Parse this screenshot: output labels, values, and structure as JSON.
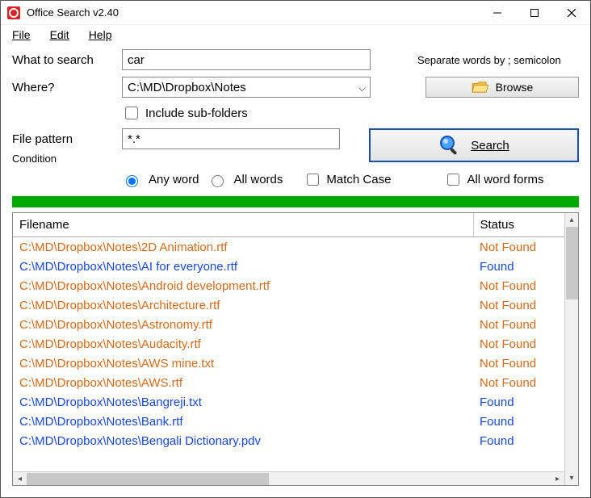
{
  "window": {
    "title": "Office Search v2.40"
  },
  "menu": {
    "file": "File",
    "edit": "Edit",
    "help": "Help"
  },
  "labels": {
    "what": "What to search",
    "where": "Where?",
    "include_sub": "Include sub-folders",
    "file_pattern": "File pattern",
    "condition": "Condition",
    "any_word": "Any word",
    "all_words": "All words",
    "match_case": "Match Case",
    "all_word_forms": "All word forms",
    "separate_hint": "Separate words by ; semicolon"
  },
  "buttons": {
    "browse": "Browse",
    "search": "Search"
  },
  "inputs": {
    "what_value": "car",
    "where_value": "C:\\MD\\Dropbox\\Notes",
    "pattern_value": "*.*"
  },
  "condition": {
    "selected": "any_word",
    "match_case": false,
    "all_word_forms": false,
    "include_sub": false
  },
  "table": {
    "headers": {
      "filename": "Filename",
      "status": "Status"
    },
    "status_labels": {
      "found": "Found",
      "not_found": "Not Found"
    },
    "rows": [
      {
        "file": "C:\\MD\\Dropbox\\Notes\\2D Animation.rtf",
        "found": false
      },
      {
        "file": "C:\\MD\\Dropbox\\Notes\\AI for everyone.rtf",
        "found": true
      },
      {
        "file": "C:\\MD\\Dropbox\\Notes\\Android development.rtf",
        "found": false
      },
      {
        "file": "C:\\MD\\Dropbox\\Notes\\Architecture.rtf",
        "found": false
      },
      {
        "file": "C:\\MD\\Dropbox\\Notes\\Astronomy.rtf",
        "found": false
      },
      {
        "file": "C:\\MD\\Dropbox\\Notes\\Audacity.rtf",
        "found": false
      },
      {
        "file": "C:\\MD\\Dropbox\\Notes\\AWS mine.txt",
        "found": false
      },
      {
        "file": "C:\\MD\\Dropbox\\Notes\\AWS.rtf",
        "found": false
      },
      {
        "file": "C:\\MD\\Dropbox\\Notes\\Bangreji.txt",
        "found": true
      },
      {
        "file": "C:\\MD\\Dropbox\\Notes\\Bank.rtf",
        "found": true
      },
      {
        "file": "C:\\MD\\Dropbox\\Notes\\Bengali Dictionary.pdv",
        "found": true
      }
    ]
  }
}
